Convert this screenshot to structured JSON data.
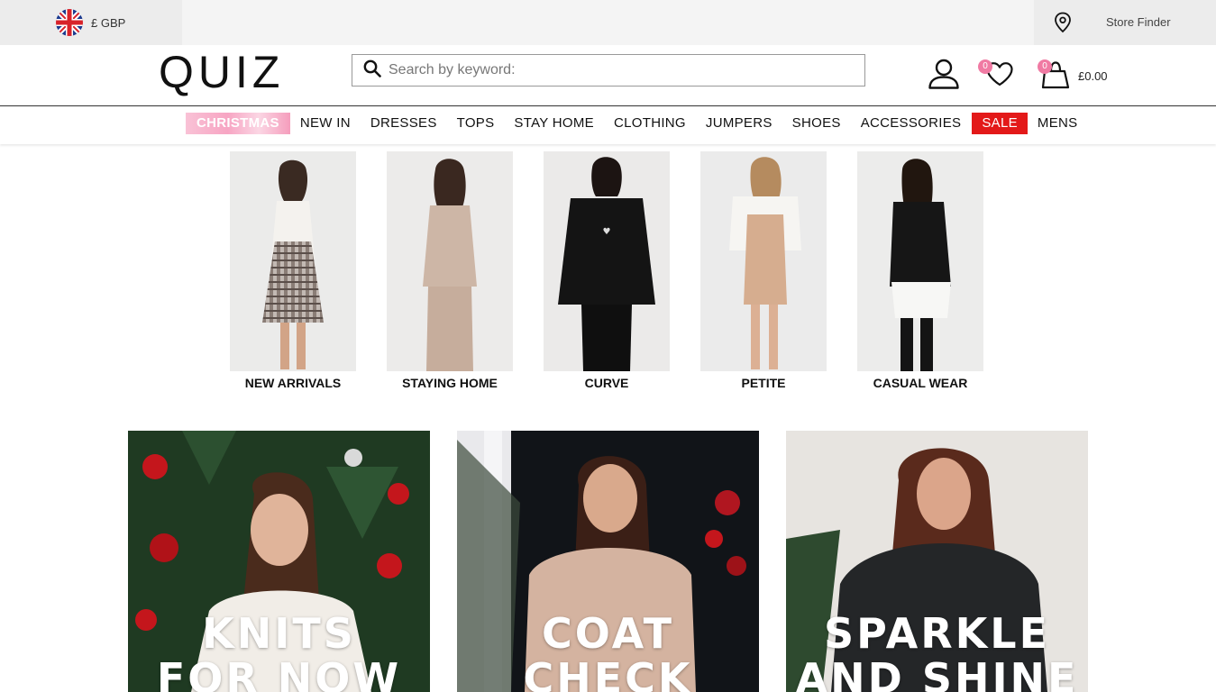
{
  "topbar": {
    "currency_label": "£ GBP",
    "store_finder_label": "Store Finder"
  },
  "header": {
    "logo_text": "QUIZ",
    "search_placeholder": "Search by keyword:",
    "wishlist_count": "0",
    "bag_count": "0",
    "bag_total": "£0.00"
  },
  "nav": {
    "items": [
      {
        "label": "CHRISTMAS"
      },
      {
        "label": "NEW IN"
      },
      {
        "label": "DRESSES"
      },
      {
        "label": "TOPS"
      },
      {
        "label": "STAY HOME"
      },
      {
        "label": "CLOTHING"
      },
      {
        "label": "JUMPERS"
      },
      {
        "label": "SHOES"
      },
      {
        "label": "ACCESSORIES"
      },
      {
        "label": "SALE"
      },
      {
        "label": "MENS"
      }
    ]
  },
  "categories": [
    {
      "label": "NEW ARRIVALS"
    },
    {
      "label": "STAYING HOME"
    },
    {
      "label": "CURVE"
    },
    {
      "label": "PETITE"
    },
    {
      "label": "CASUAL WEAR"
    }
  ],
  "promos": [
    {
      "line1": "KNITS",
      "line2": "FOR NOW"
    },
    {
      "line1": "COAT",
      "line2": "CHECK"
    },
    {
      "line1": "SPARKLE",
      "line2": "AND SHINE"
    }
  ],
  "colors": {
    "sale_red": "#e31919",
    "badge_pink": "#f07aa3",
    "christmas_pink": "#f7a5c3"
  },
  "icons": [
    "uk-flag-icon",
    "location-pin-icon",
    "search-icon",
    "user-icon",
    "heart-icon",
    "shopping-bag-icon"
  ]
}
